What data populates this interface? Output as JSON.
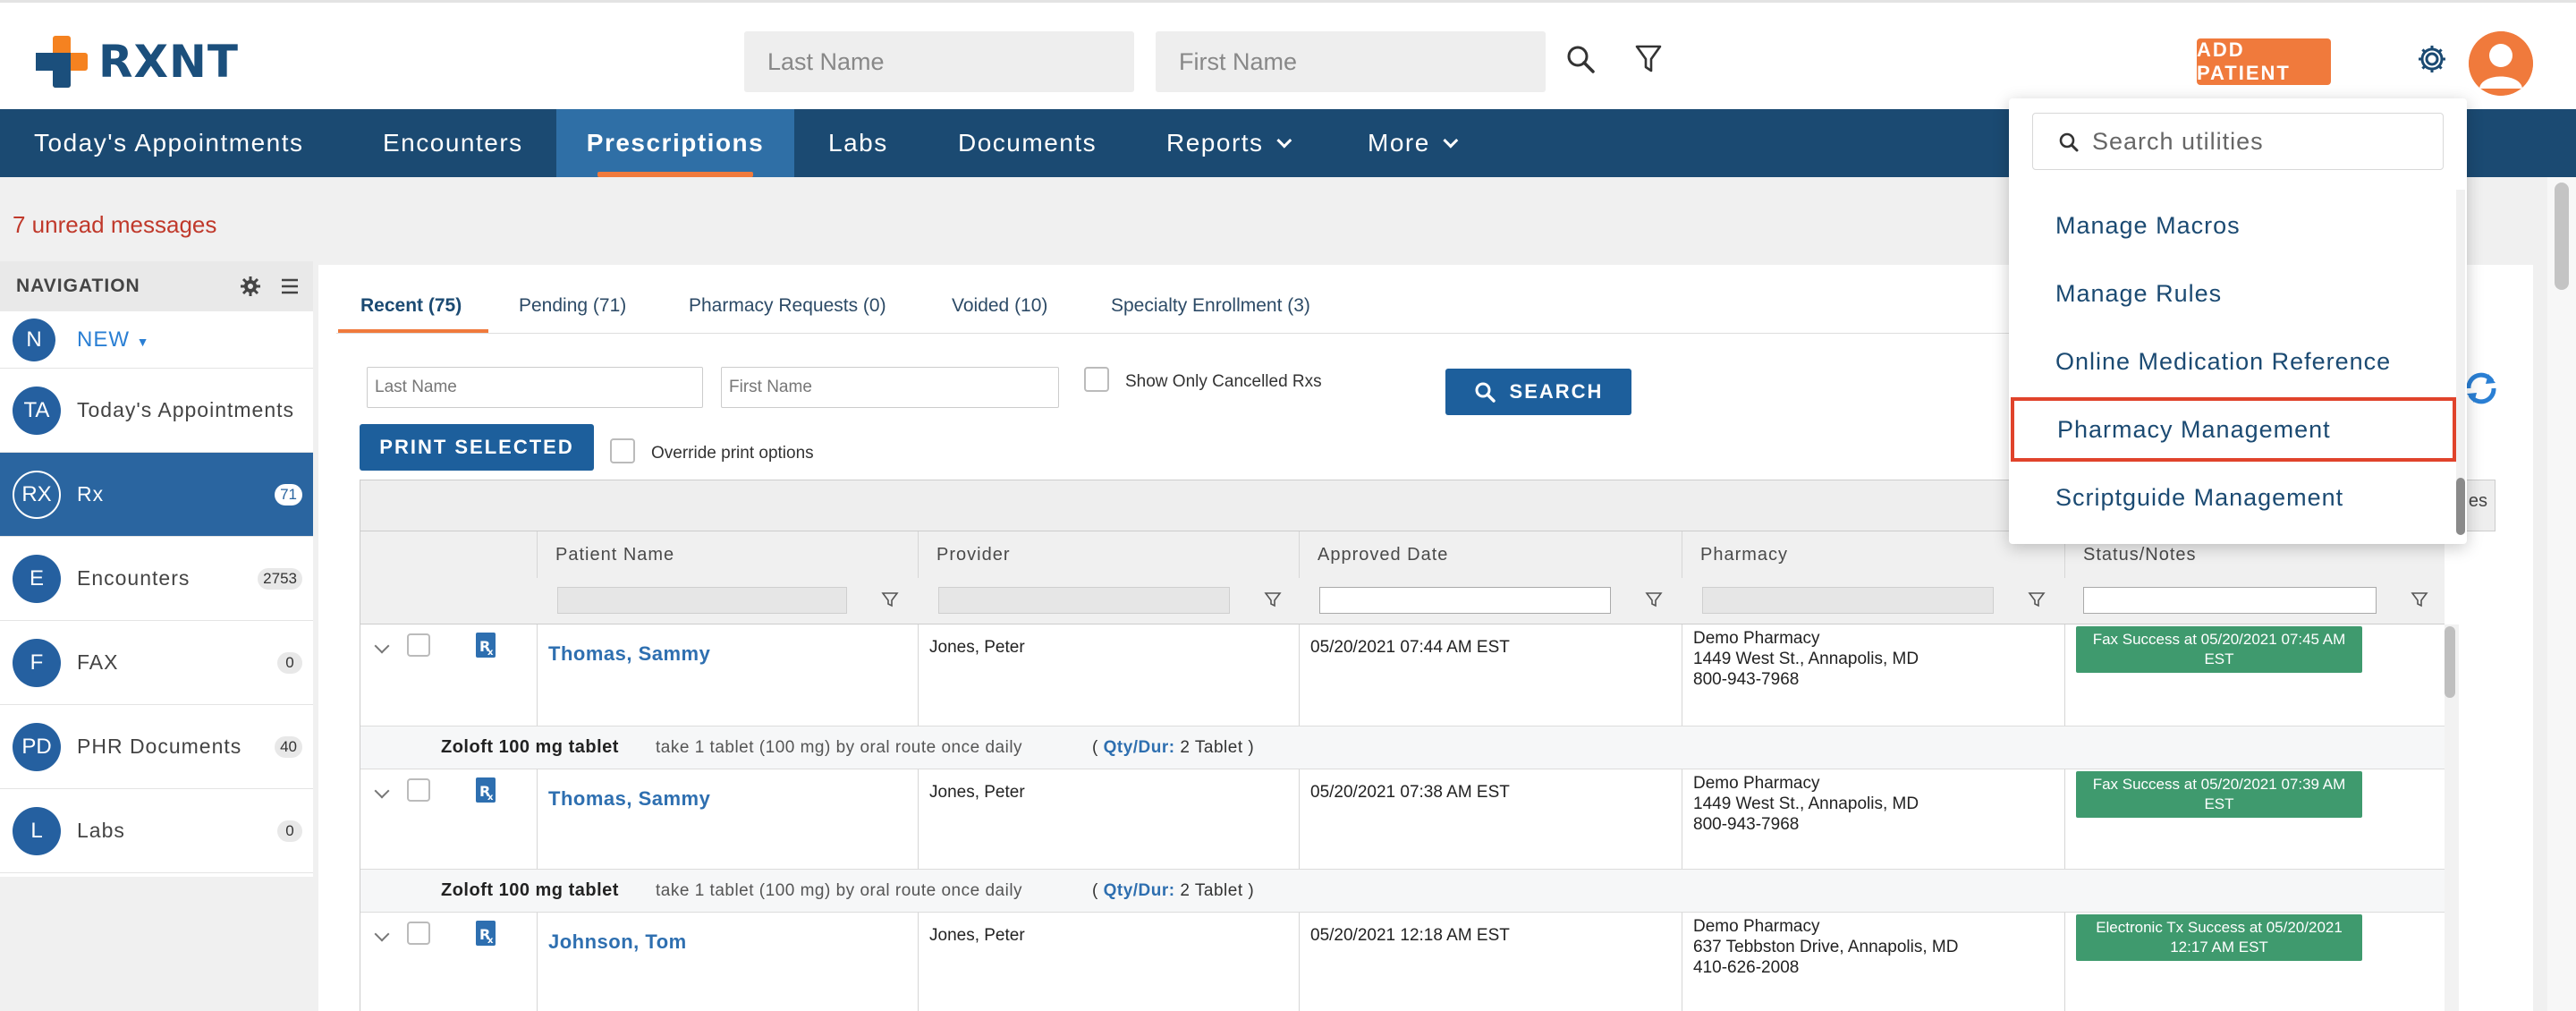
{
  "header": {
    "logo_text": "RXNT",
    "last_name_placeholder": "Last Name",
    "first_name_placeholder": "First Name",
    "add_patient_label": "ADD PATIENT"
  },
  "nav": {
    "items": [
      {
        "label": "Today's Appointments"
      },
      {
        "label": "Encounters"
      },
      {
        "label": "Prescriptions",
        "active": true
      },
      {
        "label": "Labs"
      },
      {
        "label": "Documents"
      },
      {
        "label": "Reports",
        "has_caret": true
      },
      {
        "label": "More",
        "has_caret": true
      }
    ]
  },
  "unread_messages": "7 unread messages",
  "sidebar": {
    "title": "NAVIGATION",
    "new_label": "NEW",
    "items": [
      {
        "initials": "N",
        "label": "NEW"
      },
      {
        "initials": "TA",
        "label": "Today's Appointments",
        "count": ""
      },
      {
        "initials": "RX",
        "label": "Rx",
        "count": "71",
        "active": true
      },
      {
        "initials": "E",
        "label": "Encounters",
        "count": "2753"
      },
      {
        "initials": "F",
        "label": "FAX",
        "count": "0"
      },
      {
        "initials": "PD",
        "label": "PHR Documents",
        "count": "40"
      },
      {
        "initials": "L",
        "label": "Labs",
        "count": "0"
      }
    ]
  },
  "tabs": [
    {
      "label": "Recent (75)",
      "active": true
    },
    {
      "label": "Pending (71)"
    },
    {
      "label": "Pharmacy Requests (0)"
    },
    {
      "label": "Voided (10)"
    },
    {
      "label": "Specialty Enrollment (3)"
    }
  ],
  "filters": {
    "last_name_placeholder": "Last Name",
    "first_name_placeholder": "First Name",
    "show_cancelled_label": "Show Only Cancelled Rxs",
    "search_label": "SEARCH",
    "print_selected_label": "PRINT SELECTED",
    "override_print_label": "Override print options"
  },
  "grid": {
    "top_bar_edge_text": "es",
    "columns": [
      "Patient Name",
      "Provider",
      "Approved Date",
      "Pharmacy",
      "Status/Notes"
    ],
    "rows": [
      {
        "patient": "Thomas, Sammy",
        "provider": "Jones, Peter",
        "approved": "05/20/2021 07:44 AM EST",
        "pharmacy_name": "Demo Pharmacy",
        "pharmacy_address": "1449 West St., Annapolis, MD",
        "pharmacy_phone": "800-943-7968",
        "status_line1": "Fax Success at 05/20/2021 07:45 AM",
        "status_line2": "EST",
        "drug": "Zoloft 100 mg tablet",
        "sig": "take 1 tablet (100 mg) by oral route once daily",
        "qty_prefix": "(",
        "qty_label": "Qty/Dur:",
        "qty_value": "2 Tablet )"
      },
      {
        "patient": "Thomas, Sammy",
        "provider": "Jones, Peter",
        "approved": "05/20/2021 07:38 AM EST",
        "pharmacy_name": "Demo Pharmacy",
        "pharmacy_address": "1449 West St., Annapolis, MD",
        "pharmacy_phone": "800-943-7968",
        "status_line1": "Fax Success at 05/20/2021 07:39 AM",
        "status_line2": "EST",
        "drug": "Zoloft 100 mg tablet",
        "sig": "take 1 tablet (100 mg) by oral route once daily",
        "qty_prefix": "(",
        "qty_label": "Qty/Dur:",
        "qty_value": "2 Tablet )"
      },
      {
        "patient": "Johnson, Tom",
        "provider": "Jones, Peter",
        "approved": "05/20/2021 12:18 AM EST",
        "pharmacy_name": "Demo Pharmacy",
        "pharmacy_address": "637 Tebbston Drive, Annapolis, MD",
        "pharmacy_phone": "410-626-2008",
        "status_line1": "Electronic Tx Success at 05/20/2021",
        "status_line2": "12:17 AM EST"
      }
    ]
  },
  "utilities": {
    "search_placeholder": "Search utilities",
    "items": [
      {
        "label": "Manage Macros"
      },
      {
        "label": "Manage Rules"
      },
      {
        "label": "Online Medication Reference"
      },
      {
        "label": "Pharmacy Management",
        "highlighted": true
      },
      {
        "label": "Scriptguide Management"
      }
    ]
  },
  "colors": {
    "brand_blue": "#1b4a72",
    "brand_orange": "#f07a3c",
    "status_green": "#3f9a6e",
    "highlight_red": "#e0432b"
  },
  "icons": [
    "search-icon",
    "filter-icon",
    "gear-icon",
    "user-avatar-icon",
    "hamburger-icon",
    "refresh-icon",
    "rx-icon",
    "chevron-down-icon"
  ]
}
